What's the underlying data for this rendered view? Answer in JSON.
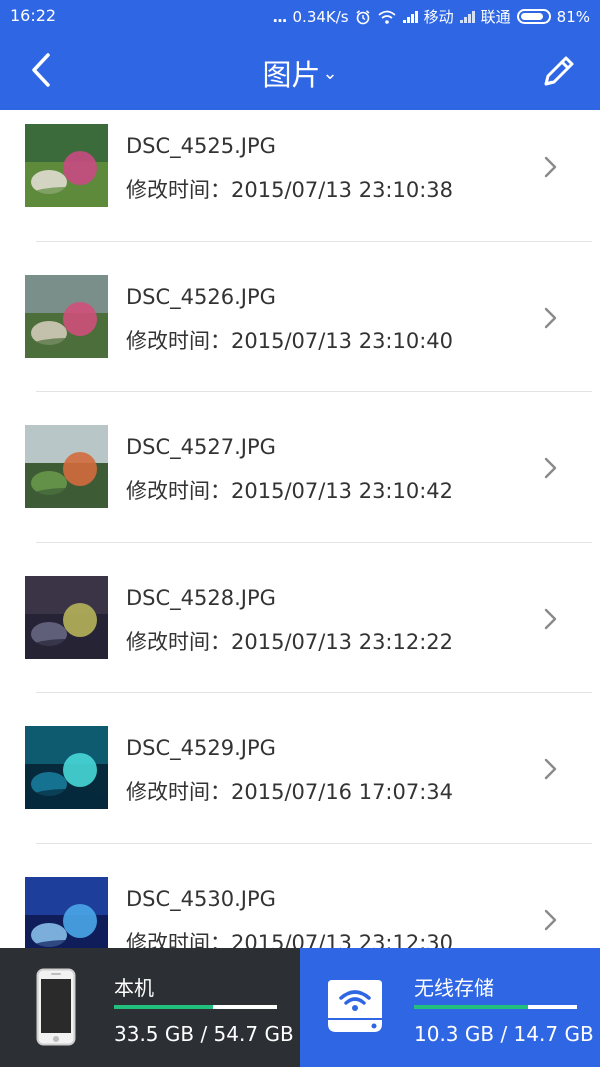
{
  "status_bar": {
    "time": "16:22",
    "dots": "...",
    "speed": "0.34K/s",
    "carrier1": "移动",
    "carrier2": "联通",
    "battery": "81%"
  },
  "header": {
    "title": "图片",
    "title_caret": "⌄",
    "back_icon": "chevron-left-icon",
    "edit_icon": "pencil-icon"
  },
  "files": [
    {
      "name": "DSC_4525.JPG",
      "modified": "修改时间：2015/07/13 23:10:38",
      "thumb_colors": [
        "#3b6b3a",
        "#c94a82",
        "#e8e0d8",
        "#5e8a3c"
      ]
    },
    {
      "name": "DSC_4526.JPG",
      "modified": "修改时间：2015/07/13 23:10:40",
      "thumb_colors": [
        "#7a8f8a",
        "#cf4f7a",
        "#d8cfc0",
        "#4c6e3a"
      ]
    },
    {
      "name": "DSC_4527.JPG",
      "modified": "修改时间：2015/07/13 23:10:42",
      "thumb_colors": [
        "#b8c6c8",
        "#d36a3d",
        "#6a9a4a",
        "#3d5c36"
      ]
    },
    {
      "name": "DSC_4528.JPG",
      "modified": "修改时间：2015/07/13 23:12:22",
      "thumb_colors": [
        "#3a3446",
        "#b6b25a",
        "#6b6a86",
        "#252335"
      ]
    },
    {
      "name": "DSC_4529.JPG",
      "modified": "修改时间：2015/07/16 17:07:34",
      "thumb_colors": [
        "#0e5a6e",
        "#48d7d6",
        "#1a7fa0",
        "#062a3c"
      ]
    },
    {
      "name": "DSC_4530.JPG",
      "modified": "修改时间：2015/07/13 23:12:30",
      "thumb_colors": [
        "#1d3e9a",
        "#4aa6e8",
        "#8ec8f2",
        "#0f1e5a"
      ]
    }
  ],
  "bottom": {
    "local": {
      "label": "本机",
      "capacity": "33.5 GB / 54.7 GB",
      "used_fraction": 0.61,
      "icon": "phone-icon"
    },
    "wireless": {
      "label": "无线存储",
      "capacity": "10.3 GB / 14.7 GB",
      "used_fraction": 0.7,
      "icon": "wifi-drive-icon"
    }
  },
  "colors": {
    "accent": "#2f66e3",
    "progress": "#22c07c",
    "local_bg": "#2c2f33"
  }
}
